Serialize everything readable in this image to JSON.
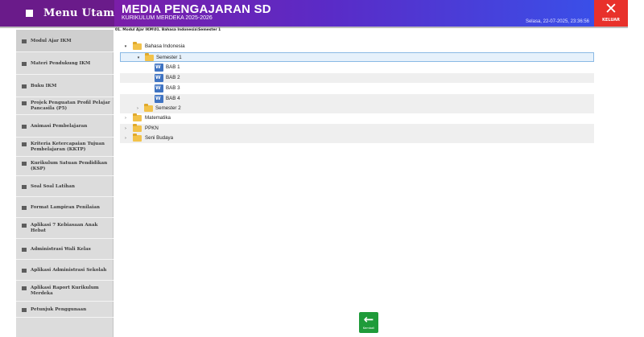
{
  "header": {
    "menu_label": "Menu Utama",
    "title": "MEDIA PENGAJARAN SD",
    "subtitle": "KURIKULUM MERDEKA 2025-2026",
    "datetime": "Selasa, 22-07-2025, 23:36:56",
    "close_label": "KELUAR",
    "close_glyph": "✕"
  },
  "breadcrumb": "01. Modul Ajar IKM\\01. Bahasa Indonesia\\Semester 1",
  "sidebar": {
    "items": [
      {
        "label": "Modul Ajar IKM",
        "active": true
      },
      {
        "label": "Materi Pendukung IKM"
      },
      {
        "label": "Buku IKM"
      },
      {
        "label": "Projek Penguatan Profil Pelajar Pancasila (P5)"
      },
      {
        "label": "Animasi Pembelajaran"
      },
      {
        "label": "Kriteria Ketercapaian Tujuan Pembelajaran (KKTP)"
      },
      {
        "label": "Kurikulum Satuan Pendidikan (KSP)"
      },
      {
        "label": "Soal Soal Latihan"
      },
      {
        "label": "Format Lampiran Penilaian"
      },
      {
        "label": "Aplikasi 7 Kebiasaan Anak Hebat"
      },
      {
        "label": "Administrasi Wali Kelas"
      },
      {
        "label": "Aplikasi Administrasi Sekolah"
      },
      {
        "label": "Aplikasi Raport Kurikulum Merdeka"
      },
      {
        "label": "Petunjuk Penggunaan"
      }
    ]
  },
  "tree": {
    "rows": [
      {
        "label": "Bahasa Indonesia",
        "type": "folder",
        "expander": "▾"
      },
      {
        "label": "Semester 1",
        "type": "folder",
        "expander": "▾",
        "selected": true
      },
      {
        "label": "BAB 1",
        "type": "document"
      },
      {
        "label": "BAB 2",
        "type": "document"
      },
      {
        "label": "BAB 3",
        "type": "document"
      },
      {
        "label": "BAB 4",
        "type": "document"
      },
      {
        "label": "Semester 2",
        "type": "folder",
        "expander": "›"
      },
      {
        "label": "Matematika",
        "type": "folder",
        "expander": "›"
      },
      {
        "label": "PPKN",
        "type": "folder",
        "expander": "›"
      },
      {
        "label": "Seni Budaya",
        "type": "folder",
        "expander": "›"
      }
    ]
  },
  "back_button": {
    "glyph": "←",
    "label": "Kembali"
  },
  "colors": {
    "title_gradient_start": "#7a1ea8",
    "title_gradient_end": "#3a4fe8",
    "menu_bg": "#6a1b8a",
    "close_bg": "#e8312b",
    "back_bg": "#1f9b3a",
    "folder": "#f2c24a",
    "doc_icon": "#3f73c2"
  }
}
